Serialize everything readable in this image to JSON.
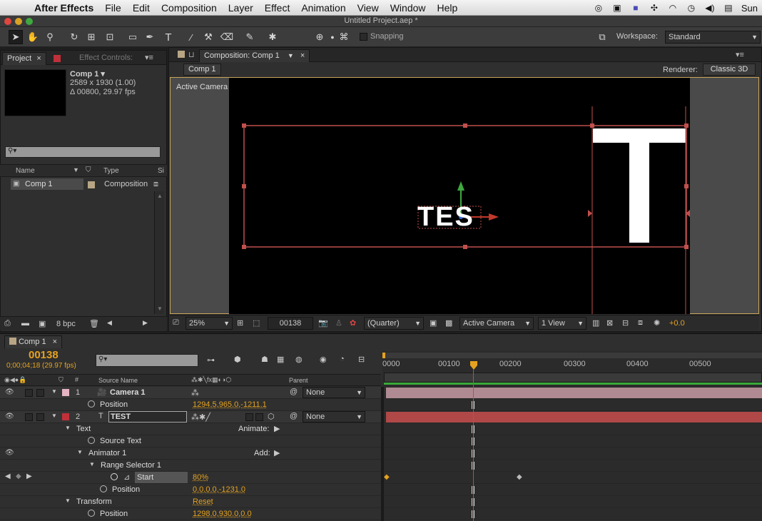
{
  "menubar": {
    "app": "After Effects",
    "items": [
      "File",
      "Edit",
      "Composition",
      "Layer",
      "Effect",
      "Animation",
      "View",
      "Window",
      "Help"
    ],
    "clock": "Sun"
  },
  "window": {
    "title": "Untitled Project.aep *"
  },
  "toolbar": {
    "snapping_label": "Snapping",
    "workspace_label": "Workspace:",
    "workspace_value": "Standard"
  },
  "project": {
    "tab_project": "Project",
    "tab_effect_controls": "Effect Controls:",
    "item_name": "Comp 1 ▾",
    "item_size": "2589 x 1930 (1.00)",
    "item_duration": "Δ 00800, 29.97 fps",
    "col_name": "Name",
    "col_type": "Type",
    "col_size": "Si",
    "row_name": "Comp 1",
    "row_type": "Composition",
    "bpc": "8 bpc"
  },
  "composition": {
    "tab_label": "Composition: Comp 1",
    "breadcrumb": "Comp 1",
    "renderer_label": "Renderer:",
    "renderer_value": "Classic 3D",
    "view_label": "Active Camera",
    "canvas_text": "TES",
    "big_letter": "T",
    "zoom": "25%",
    "timecode": "00138",
    "resolution": "(Quarter)",
    "camera": "Active Camera",
    "views": "1 View",
    "exposure": "+0.0"
  },
  "timeline": {
    "tab_label": "Comp 1",
    "current_frame": "00138",
    "current_time": "0;00;04;18 (29.97 fps)",
    "col_source": "Source Name",
    "col_parent": "Parent",
    "ruler": [
      "0000",
      "00100",
      "00200",
      "00300",
      "00400",
      "00500"
    ],
    "rows": [
      {
        "id": "1",
        "name": "Camera 1",
        "parent": "None"
      },
      {
        "label": "Position",
        "value": "1294.5,965.0,-1211.1"
      },
      {
        "id": "2",
        "name": "TEST",
        "parent": "None"
      },
      {
        "label": "Text",
        "right": "Animate:"
      },
      {
        "label": "Source Text"
      },
      {
        "label": "Animator 1",
        "right": "Add:"
      },
      {
        "label": "Range Selector 1"
      },
      {
        "label": "Start",
        "value": "80%"
      },
      {
        "label": "Position",
        "value": "0.0,0.0,-1231.0"
      },
      {
        "label": "Transform",
        "value": "Reset"
      },
      {
        "label": "Position",
        "value": "1298.0,930.0,0.0"
      }
    ]
  },
  "colors": {
    "accent_orange": "#e5a21f",
    "camera_bar": "#b08a92",
    "text_bar": "#b04848",
    "selection_red": "#c0504d",
    "timebar_green": "#39a839"
  }
}
